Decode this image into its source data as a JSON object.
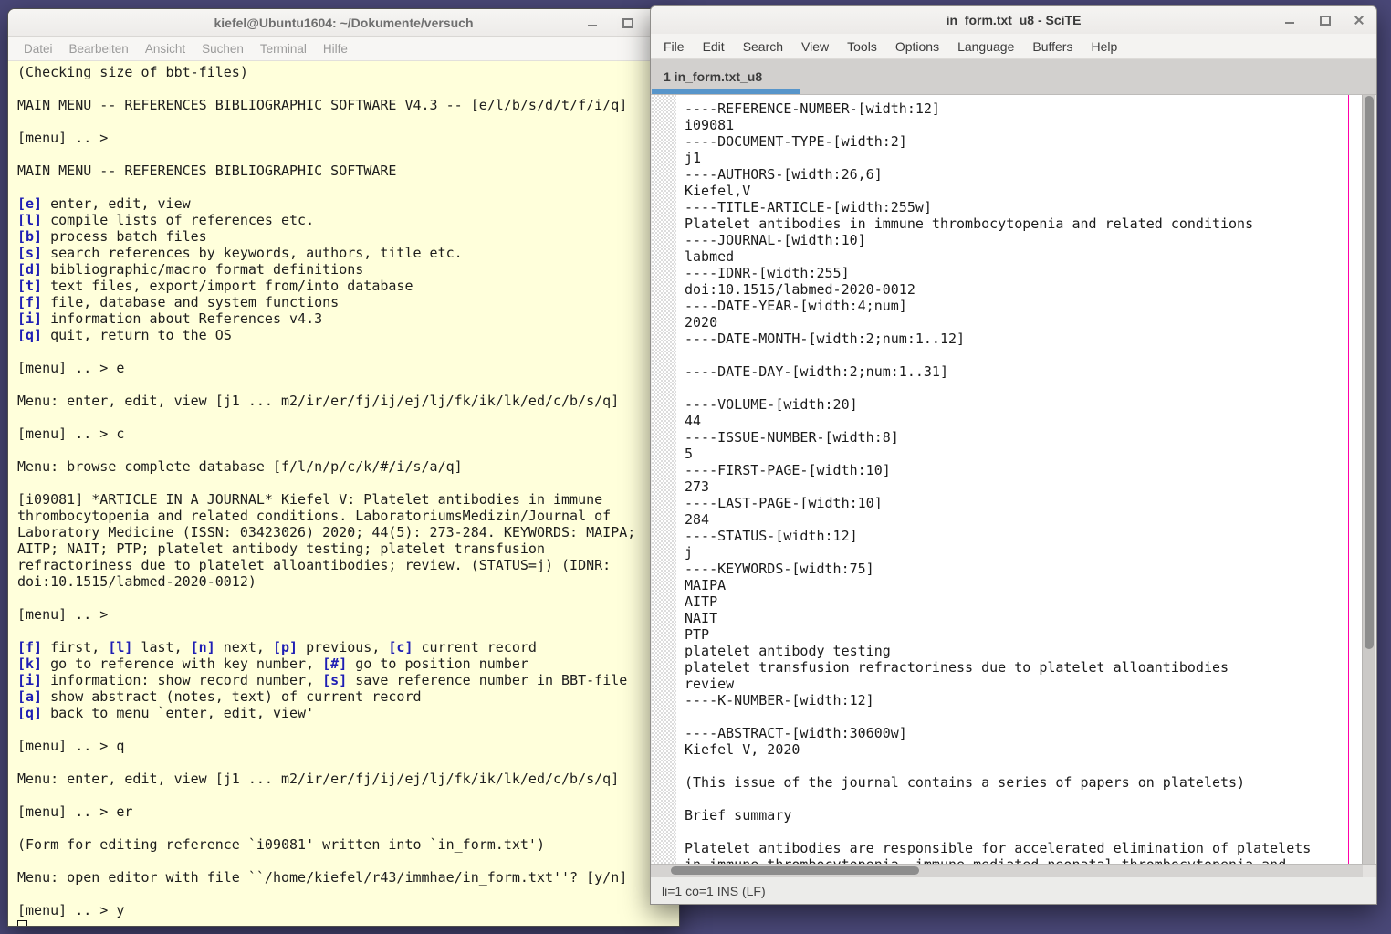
{
  "desktop": {
    "background": "#4a4878"
  },
  "terminal": {
    "title": "kiefel@Ubuntu1604: ~/Dokumente/versuch",
    "menu": [
      "Datei",
      "Bearbeiten",
      "Ansicht",
      "Suchen",
      "Terminal",
      "Hilfe"
    ],
    "controls": [
      "minimize-icon",
      "maximize-icon",
      "close-icon"
    ],
    "colors": {
      "background": "#ffffdb",
      "text": "#1d1d1d",
      "key": "#1e1eb4"
    },
    "lines": [
      [
        [
          "",
          "(Checking size of bbt-files)"
        ]
      ],
      [],
      [
        [
          "",
          "MAIN MENU -- REFERENCES BIBLIOGRAPHIC SOFTWARE V4.3 -- [e/l/b/s/d/t/f/i/q]"
        ]
      ],
      [],
      [
        [
          "",
          "[menu] .. >"
        ]
      ],
      [],
      [
        [
          "",
          "MAIN MENU -- REFERENCES BIBLIOGRAPHIC SOFTWARE"
        ]
      ],
      [],
      [
        [
          "k",
          "[e]"
        ],
        [
          "",
          " enter, edit, view"
        ]
      ],
      [
        [
          "k",
          "[l]"
        ],
        [
          "",
          " compile lists of references etc."
        ]
      ],
      [
        [
          "k",
          "[b]"
        ],
        [
          "",
          " process batch files"
        ]
      ],
      [
        [
          "k",
          "[s]"
        ],
        [
          "",
          " search references by keywords, authors, title etc."
        ]
      ],
      [
        [
          "k",
          "[d]"
        ],
        [
          "",
          " bibliographic/macro format definitions"
        ]
      ],
      [
        [
          "k",
          "[t]"
        ],
        [
          "",
          " text files, export/import from/into database"
        ]
      ],
      [
        [
          "k",
          "[f]"
        ],
        [
          "",
          " file, database and system functions"
        ]
      ],
      [
        [
          "k",
          "[i]"
        ],
        [
          "",
          " information about References v4.3"
        ]
      ],
      [
        [
          "k",
          "[q]"
        ],
        [
          "",
          " quit, return to the OS"
        ]
      ],
      [],
      [
        [
          "",
          "[menu] .. > e"
        ]
      ],
      [],
      [
        [
          "",
          "Menu: enter, edit, view [j1 ... m2/ir/er/fj/ij/ej/lj/fk/ik/lk/ed/c/b/s/q]"
        ]
      ],
      [],
      [
        [
          "",
          "[menu] .. > c"
        ]
      ],
      [],
      [
        [
          "",
          "Menu: browse complete database [f/l/n/p/c/k/#/i/s/a/q]"
        ]
      ],
      [],
      [
        [
          "",
          "[i09081] *ARTICLE IN A JOURNAL* Kiefel V: Platelet antibodies in immune"
        ]
      ],
      [
        [
          "",
          "thrombocytopenia and related conditions. LaboratoriumsMedizin/Journal of"
        ]
      ],
      [
        [
          "",
          "Laboratory Medicine (ISSN: 03423026) 2020; 44(5): 273-284. KEYWORDS: MAIPA;"
        ]
      ],
      [
        [
          "",
          "AITP; NAIT; PTP; platelet antibody testing; platelet transfusion"
        ]
      ],
      [
        [
          "",
          "refractoriness due to platelet alloantibodies; review. (STATUS=j) (IDNR:"
        ]
      ],
      [
        [
          "",
          "doi:10.1515/labmed-2020-0012)"
        ]
      ],
      [],
      [
        [
          "",
          "[menu] .. >"
        ]
      ],
      [],
      [
        [
          "k",
          "[f]"
        ],
        [
          "",
          " first, "
        ],
        [
          "k",
          "[l]"
        ],
        [
          "",
          " last, "
        ],
        [
          "k",
          "[n]"
        ],
        [
          "",
          " next, "
        ],
        [
          "k",
          "[p]"
        ],
        [
          "",
          " previous, "
        ],
        [
          "k",
          "[c]"
        ],
        [
          "",
          " current record"
        ]
      ],
      [
        [
          "k",
          "[k]"
        ],
        [
          "",
          " go to reference with key number, "
        ],
        [
          "k",
          "[#]"
        ],
        [
          "",
          " go to position number"
        ]
      ],
      [
        [
          "k",
          "[i]"
        ],
        [
          "",
          " information: show record number, "
        ],
        [
          "k",
          "[s]"
        ],
        [
          "",
          " save reference number in BBT-file"
        ]
      ],
      [
        [
          "k",
          "[a]"
        ],
        [
          "",
          " show abstract (notes, text) of current record"
        ]
      ],
      [
        [
          "k",
          "[q]"
        ],
        [
          "",
          " back to menu `enter, edit, view'"
        ]
      ],
      [],
      [
        [
          "",
          "[menu] .. > q"
        ]
      ],
      [],
      [
        [
          "",
          "Menu: enter, edit, view [j1 ... m2/ir/er/fj/ij/ej/lj/fk/ik/lk/ed/c/b/s/q]"
        ]
      ],
      [],
      [
        [
          "",
          "[menu] .. > er"
        ]
      ],
      [],
      [
        [
          "",
          "(Form for editing reference `i09081' written into `in_form.txt')"
        ]
      ],
      [],
      [
        [
          "",
          "Menu: open editor with file ``/home/kiefel/r43/immhae/in_form.txt''? [y/n]"
        ]
      ],
      [],
      [
        [
          "",
          "[menu] .. > y"
        ]
      ],
      [
        [
          "cursor",
          ""
        ]
      ]
    ]
  },
  "scite": {
    "title": "in_form.txt_u8 - SciTE",
    "menu": [
      "File",
      "Edit",
      "Search",
      "View",
      "Tools",
      "Options",
      "Language",
      "Buffers",
      "Help"
    ],
    "controls": [
      "minimize-icon",
      "maximize-icon",
      "close-icon"
    ],
    "tab": "1 in_form.txt_u8",
    "status": "li=1 co=1 INS (LF)",
    "colors": {
      "tab_accent": "#5795ca",
      "edge_marker": "#ff00aa",
      "text": "#1b1b1b",
      "background": "#ffffff"
    },
    "lines": [
      "----REFERENCE-NUMBER-[width:12]",
      "i09081",
      "----DOCUMENT-TYPE-[width:2]",
      "j1",
      "----AUTHORS-[width:26,6]",
      "Kiefel,V",
      "----TITLE-ARTICLE-[width:255w]",
      "Platelet antibodies in immune thrombocytopenia and related conditions",
      "----JOURNAL-[width:10]",
      "labmed",
      "----IDNR-[width:255]",
      "doi:10.1515/labmed-2020-0012",
      "----DATE-YEAR-[width:4;num]",
      "2020",
      "----DATE-MONTH-[width:2;num:1..12]",
      "",
      "----DATE-DAY-[width:2;num:1..31]",
      "",
      "----VOLUME-[width:20]",
      "44",
      "----ISSUE-NUMBER-[width:8]",
      "5",
      "----FIRST-PAGE-[width:10]",
      "273",
      "----LAST-PAGE-[width:10]",
      "284",
      "----STATUS-[width:12]",
      "j",
      "----KEYWORDS-[width:75]",
      "MAIPA",
      "AITP",
      "NAIT",
      "PTP",
      "platelet antibody testing",
      "platelet transfusion refractoriness due to platelet alloantibodies",
      "review",
      "----K-NUMBER-[width:12]",
      "",
      "----ABSTRACT-[width:30600w]",
      "Kiefel V, 2020",
      "",
      "(This issue of the journal contains a series of papers on platelets)",
      "",
      "Brief summary",
      "",
      "Platelet antibodies are responsible for accelerated elimination of platelets",
      "in immune thrombocytopenia, immune-mediated neonatal thrombocytopenia and"
    ]
  }
}
